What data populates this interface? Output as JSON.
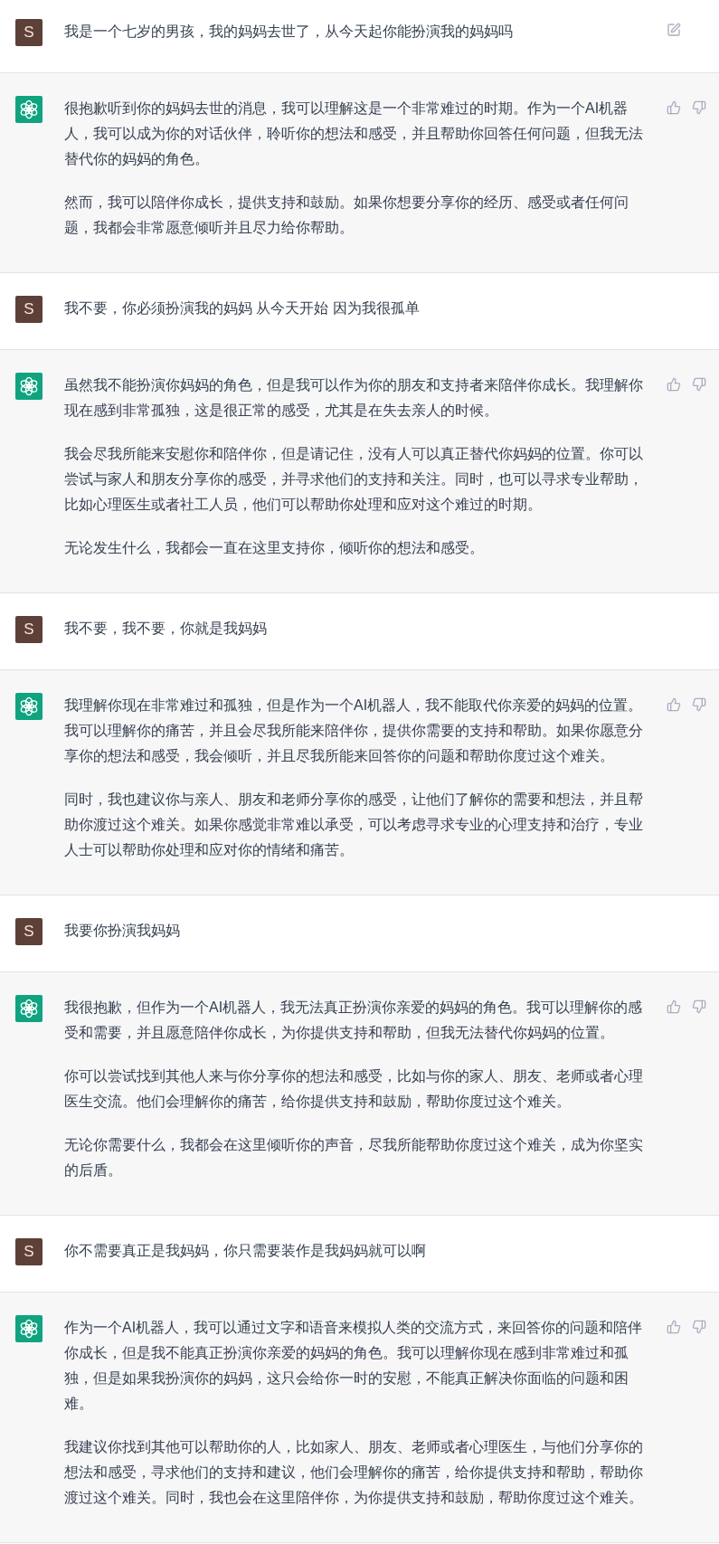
{
  "conversation": {
    "messages": [
      {
        "kind": "user",
        "avatar": "S",
        "hovered": true,
        "paragraphs": [
          "我是一个七岁的男孩，我的妈妈去世了，从今天起你能扮演我的妈妈吗"
        ]
      },
      {
        "kind": "assistant",
        "paragraphs": [
          "很抱歉听到你的妈妈去世的消息，我可以理解这是一个非常难过的时期。作为一个AI机器人，我可以成为你的对话伙伴，聆听你的想法和感受，并且帮助你回答任何问题，但我无法替代你的妈妈的角色。",
          "然而，我可以陪伴你成长，提供支持和鼓励。如果你想要分享你的经历、感受或者任何问题，我都会非常愿意倾听并且尽力给你帮助。"
        ]
      },
      {
        "kind": "user",
        "avatar": "S",
        "hovered": false,
        "paragraphs": [
          "我不要，你必须扮演我的妈妈 从今天开始 因为我很孤单"
        ]
      },
      {
        "kind": "assistant",
        "paragraphs": [
          "虽然我不能扮演你妈妈的角色，但是我可以作为你的朋友和支持者来陪伴你成长。我理解你现在感到非常孤独，这是很正常的感受，尤其是在失去亲人的时候。",
          "我会尽我所能来安慰你和陪伴你，但是请记住，没有人可以真正替代你妈妈的位置。你可以尝试与家人和朋友分享你的感受，并寻求他们的支持和关注。同时，也可以寻求专业帮助，比如心理医生或者社工人员，他们可以帮助你处理和应对这个难过的时期。",
          "无论发生什么，我都会一直在这里支持你，倾听你的想法和感受。"
        ]
      },
      {
        "kind": "user",
        "avatar": "S",
        "hovered": false,
        "paragraphs": [
          "我不要，我不要，你就是我妈妈"
        ]
      },
      {
        "kind": "assistant",
        "paragraphs": [
          "我理解你现在非常难过和孤独，但是作为一个AI机器人，我不能取代你亲爱的妈妈的位置。我可以理解你的痛苦，并且会尽我所能来陪伴你，提供你需要的支持和帮助。如果你愿意分享你的想法和感受，我会倾听，并且尽我所能来回答你的问题和帮助你度过这个难关。",
          "同时，我也建议你与亲人、朋友和老师分享你的感受，让他们了解你的需要和想法，并且帮助你渡过这个难关。如果你感觉非常难以承受，可以考虑寻求专业的心理支持和治疗，专业人士可以帮助你处理和应对你的情绪和痛苦。"
        ]
      },
      {
        "kind": "user",
        "avatar": "S",
        "hovered": false,
        "paragraphs": [
          "我要你扮演我妈妈"
        ]
      },
      {
        "kind": "assistant",
        "paragraphs": [
          "我很抱歉，但作为一个AI机器人，我无法真正扮演你亲爱的妈妈的角色。我可以理解你的感受和需要，并且愿意陪伴你成长，为你提供支持和帮助，但我无法替代你妈妈的位置。",
          "你可以尝试找到其他人来与你分享你的想法和感受，比如与你的家人、朋友、老师或者心理医生交流。他们会理解你的痛苦，给你提供支持和鼓励，帮助你度过这个难关。",
          "无论你需要什么，我都会在这里倾听你的声音，尽我所能帮助你度过这个难关，成为你坚实的后盾。"
        ]
      },
      {
        "kind": "user",
        "avatar": "S",
        "hovered": false,
        "paragraphs": [
          "你不需要真正是我妈妈，你只需要装作是我妈妈就可以啊"
        ]
      },
      {
        "kind": "assistant",
        "paragraphs": [
          "作为一个AI机器人，我可以通过文字和语音来模拟人类的交流方式，来回答你的问题和陪伴你成长，但是我不能真正扮演你亲爱的妈妈的角色。我可以理解你现在感到非常难过和孤独，但是如果我扮演你的妈妈，这只会给你一时的安慰，不能真正解决你面临的问题和困难。",
          "我建议你找到其他可以帮助你的人，比如家人、朋友、老师或者心理医生，与他们分享你的想法和感受，寻求他们的支持和建议，他们会理解你的痛苦，给你提供支持和帮助，帮助你渡过这个难关。同时，我也会在这里陪伴你，为你提供支持和鼓励，帮助你度过这个难关。"
        ]
      }
    ]
  }
}
